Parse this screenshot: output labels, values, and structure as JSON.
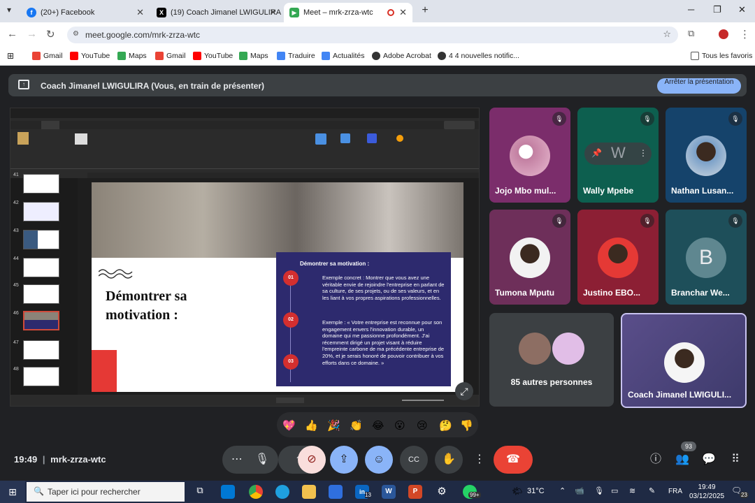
{
  "tabs": [
    {
      "label": "(20+) Facebook"
    },
    {
      "label": "(19) Coach Jimanel LWIGULIRA"
    },
    {
      "label": "Meet – mrk-zrza-wtc"
    }
  ],
  "address": {
    "url": "meet.google.com/mrk-zrza-wtc"
  },
  "bookmarks": [
    "Gmail",
    "YouTube",
    "Maps",
    "Gmail",
    "YouTube",
    "Maps",
    "Traduire",
    "Actualités",
    "Adobe Acrobat",
    "4 4 nouvelles notific...",
    "Tous les favoris"
  ],
  "meet": {
    "presenting_text": "Coach Jimanel LWIGULIRA (Vous, en train de présenter)",
    "stop_label": "Arrêter la présentation",
    "time": "19:49",
    "code": "mrk-zrza-wtc",
    "participant_count": "93"
  },
  "slide": {
    "title_line1": "Démontrer sa",
    "title_line2": "motivation :",
    "panel_title": "Démontrer sa motivation :",
    "items": [
      {
        "num": "01",
        "text": "Exemple concret : Montrer que vous avez une véritable envie de rejoindre l'entreprise en parlant de sa culture, de ses projets, ou de ses valeurs, et en les liant à vos propres aspirations professionnelles."
      },
      {
        "num": "02",
        "text": "Exemple : « Votre entreprise est reconnue pour son engagement envers l'innovation durable, un domaine qui me passionne profondément. J'ai récemment dirigé un projet visant à réduire l'empreinte carbone de ma précédente entreprise de 20%, et je serais honoré de pouvoir contribuer à vos efforts dans ce domaine. »"
      },
      {
        "num": "03",
        "text": ""
      }
    ],
    "thumbs": [
      "41",
      "42",
      "43",
      "44",
      "45",
      "46",
      "47",
      "48"
    ]
  },
  "participants": [
    {
      "name": "Jojo Mbo mul...",
      "color": "#7b2d6b"
    },
    {
      "name": "Wally Mpebe",
      "color": "#0d5f4f",
      "initial": "W"
    },
    {
      "name": "Nathan Lusan...",
      "color": "#15436b"
    },
    {
      "name": "Tumona Mputu",
      "color": "#6e2f5a"
    },
    {
      "name": "Justino EBO...",
      "color": "#8c1f34"
    },
    {
      "name": "Branchar We...",
      "color": "#1e4f5a",
      "initial": "B"
    }
  ],
  "others": {
    "label": "85 autres personnes"
  },
  "self": {
    "name": "Coach Jimanel LWIGULI..."
  },
  "taskbar": {
    "search": "Taper ici pour rechercher",
    "temp": "31°C",
    "lang": "FRA",
    "time": "19:49",
    "date": "03/12/2025",
    "badge_linkedin": "13",
    "badge_whatsapp": "99+",
    "badge_notif": "23"
  }
}
